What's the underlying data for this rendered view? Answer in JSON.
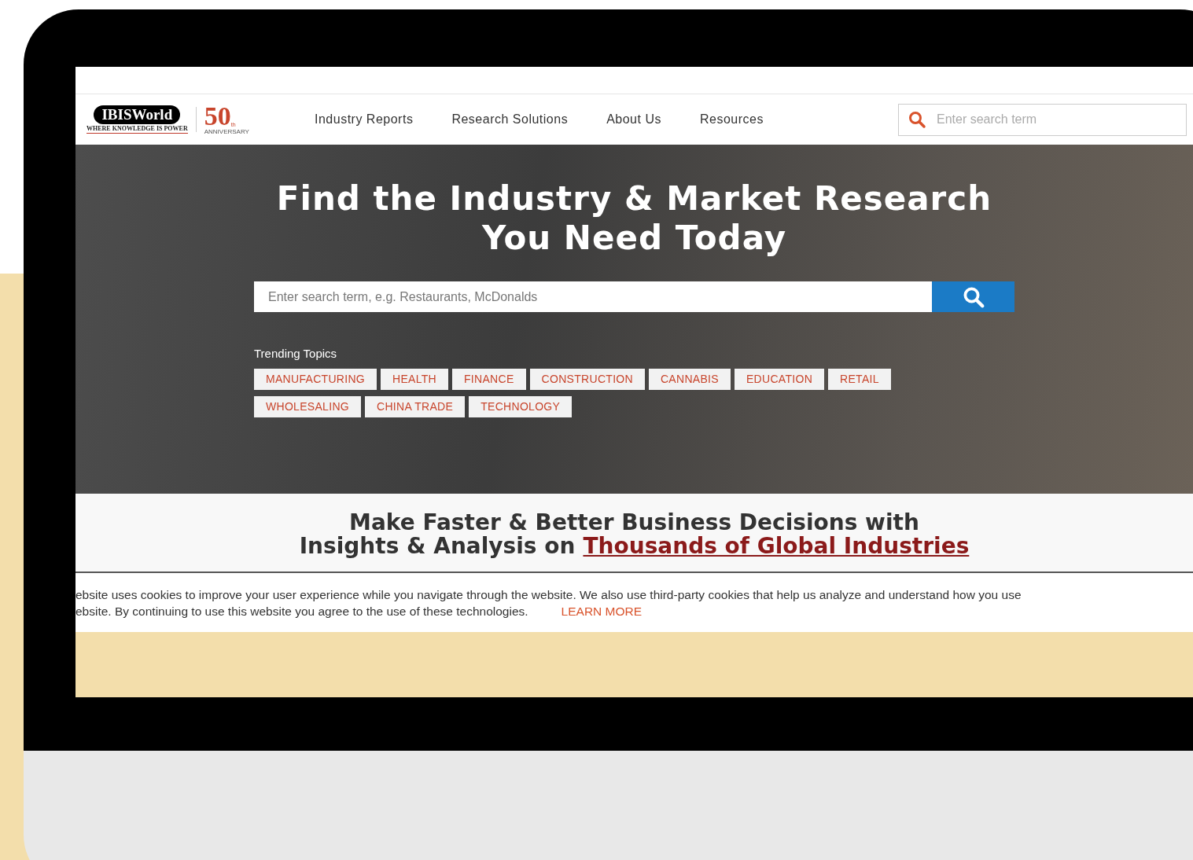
{
  "logo": {
    "brand": "IBISWorld",
    "tagline": "WHERE KNOWLEDGE IS POWER",
    "anniversary_number": "50",
    "anniversary_suffix": "th",
    "anniversary_label": "ANNIVERSARY"
  },
  "nav": {
    "items": [
      "Industry Reports",
      "Research Solutions",
      "About Us",
      "Resources"
    ],
    "search": {
      "placeholder": "Enter search term"
    }
  },
  "hero": {
    "title_lines": [
      "Find the Industry & Market Research",
      "You Need Today"
    ],
    "search": {
      "placeholder": "Enter search term, e.g. Restaurants, McDonalds"
    },
    "trending_label": "Trending Topics",
    "topics": [
      [
        "MANUFACTURING",
        "HEALTH",
        "FINANCE",
        "CONSTRUCTION",
        "CANNABIS",
        "EDUCATION",
        "RETAIL"
      ],
      [
        "WHOLESALING",
        "CHINA TRADE",
        "TECHNOLOGY"
      ]
    ]
  },
  "section": {
    "line_1": "Make Faster & Better Business Decisions with",
    "line_2": "Insights & Analysis on",
    "link": "Thousands of Global Industries"
  },
  "cookie_banner": {
    "lines": [
      "ebsite uses cookies to improve your user experience while you navigate through the website. We also use third-party cookies that help us analyze and understand how you use",
      "ebsite. By continuing to use this website you agree to the use of these technologies."
    ],
    "link": "LEARN MORE"
  }
}
